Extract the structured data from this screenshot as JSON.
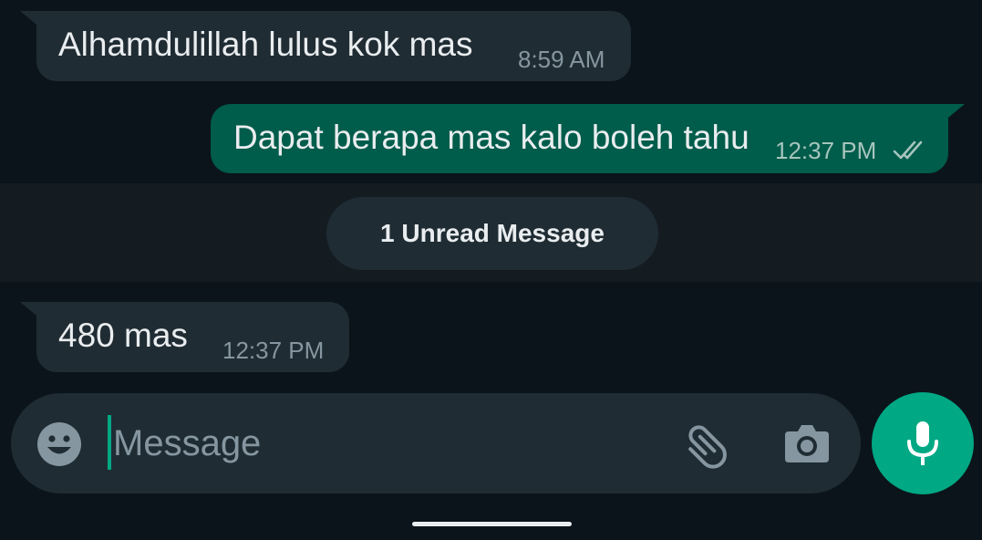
{
  "chat": {
    "messages": [
      {
        "direction": "incoming",
        "text": "Alhamdulillah lulus kok mas",
        "time": "8:59 AM"
      },
      {
        "direction": "outgoing",
        "text": "Dapat berapa mas kalo boleh tahu",
        "time": "12:37 PM",
        "status": "read-double-tick"
      },
      {
        "direction": "incoming",
        "text": "480 mas",
        "time": "12:37 PM"
      }
    ],
    "unread_label": "1 Unread Message"
  },
  "composer": {
    "placeholder": "Message",
    "value": "",
    "icons": {
      "emoji": "emoji-icon",
      "attach": "paperclip-icon",
      "camera": "camera-icon",
      "mic": "microphone-icon"
    }
  },
  "colors": {
    "background": "#0b141a",
    "incoming_bubble": "#202c33",
    "outgoing_bubble": "#005c4b",
    "accent": "#00a884",
    "timestamp": "#8696a0"
  }
}
